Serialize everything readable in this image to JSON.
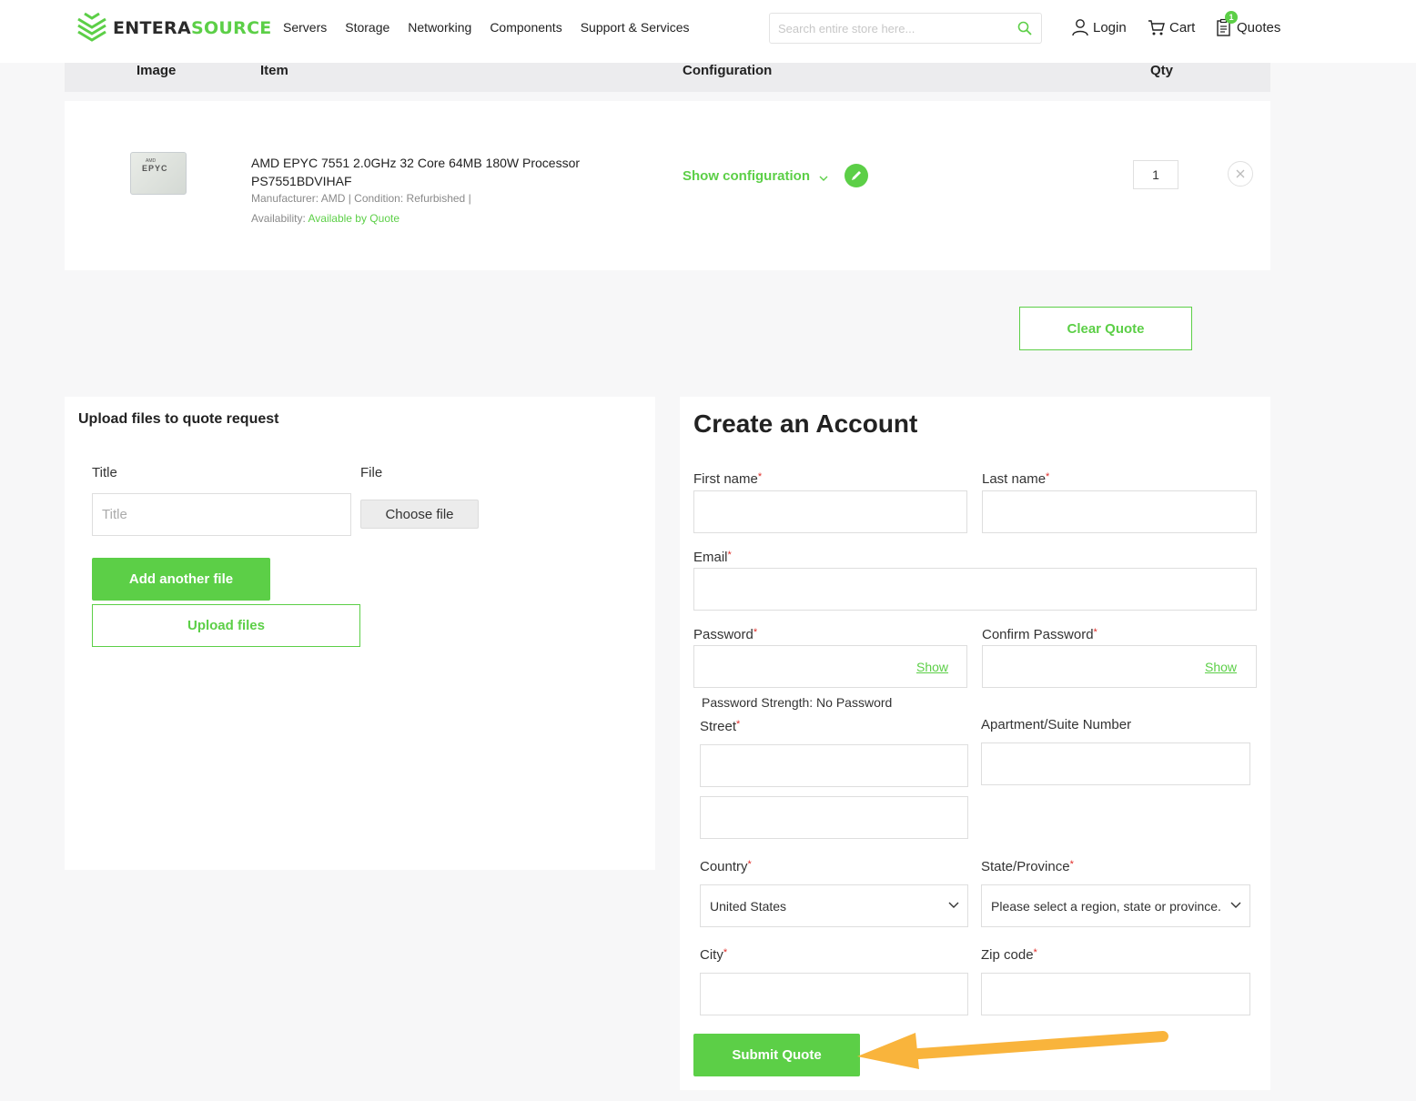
{
  "brand": {
    "part1": "ENTERA",
    "part2": "SOURCE",
    "green": "#5ccf47"
  },
  "nav": [
    "Servers",
    "Storage",
    "Networking",
    "Components",
    "Support & Services"
  ],
  "search": {
    "placeholder": "Search entire store here..."
  },
  "header_links": {
    "login": "Login",
    "cart": "Cart",
    "quotes": "Quotes",
    "quotes_count": "1"
  },
  "table": {
    "col_image": "Image",
    "col_item": "Item",
    "col_config": "Configuration",
    "col_qty": "Qty"
  },
  "item": {
    "name": "AMD EPYC 7551 2.0GHz 32 Core 64MB 180W Processor PS7551BDVIHAF",
    "thumb_brand": "AMD",
    "thumb_text": "EPYC",
    "meta": "Manufacturer: AMD |  Condition: Refurbished |",
    "availability_label": "Availability:",
    "availability_value": "Available by Quote",
    "show_config": "Show configuration",
    "qty": "1"
  },
  "clear_quote": "Clear Quote",
  "upload": {
    "heading": "Upload files to quote request",
    "title_label": "Title",
    "file_label": "File",
    "title_placeholder": "Title",
    "choose_file": "Choose file",
    "add_another": "Add another file",
    "upload_files": "Upload files"
  },
  "account": {
    "heading": "Create an Account",
    "first_name": "First name",
    "last_name": "Last name",
    "email": "Email",
    "password": "Password",
    "confirm_password": "Confirm Password",
    "show": "Show",
    "password_strength": "Password Strength: No Password",
    "street": "Street",
    "apartment": "Apartment/Suite Number",
    "country": "Country",
    "country_value": "United States",
    "state": "State/Province",
    "state_value": "Please select a region, state or province.",
    "city": "City",
    "zip": "Zip code",
    "required_mark": "*",
    "submit": "Submit Quote"
  },
  "annotation": {
    "arrow_color": "#f9b43c"
  }
}
